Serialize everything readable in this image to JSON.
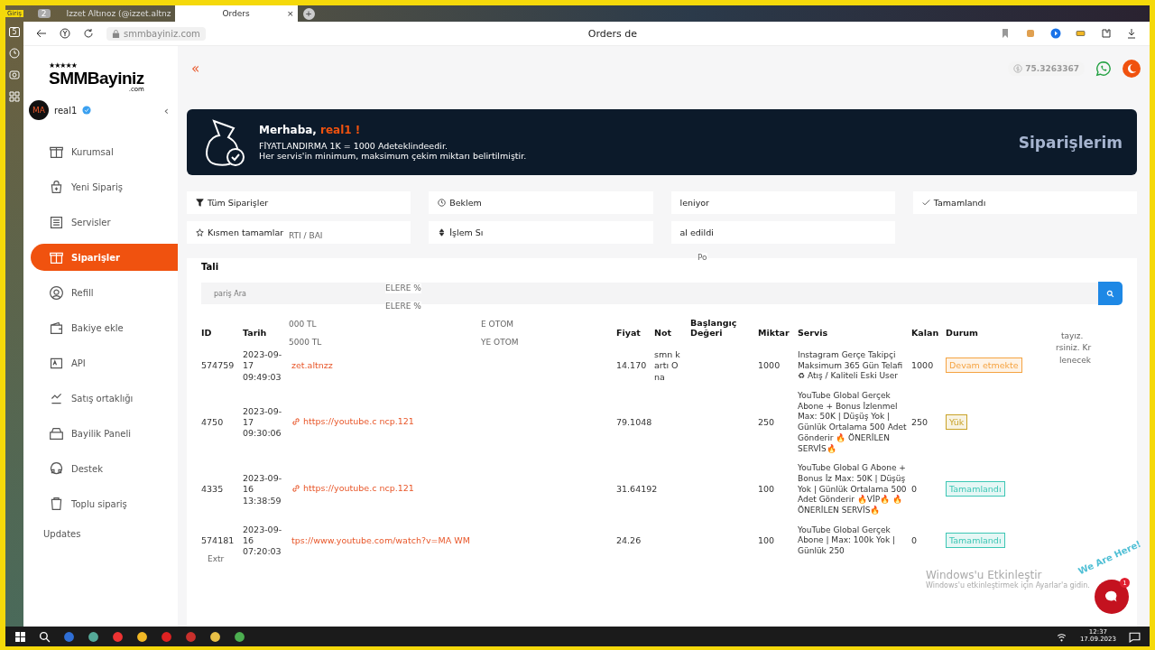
{
  "browser": {
    "corner_label": "Giriş",
    "tab_count": "2",
    "side_badge": "5",
    "tabs": [
      {
        "label": "Izzet Altınoz (@izzet.altnz",
        "selected": false
      },
      {
        "label": "Orders",
        "selected": true
      }
    ],
    "close": "×",
    "new_tab": "+",
    "url": "smmbayiniz.com",
    "page_title": "Orders de"
  },
  "sidebar": {
    "logo_stars": "★★★★★",
    "logo": "SMMBayiniz",
    "logo_sub": ".com",
    "avatar": "MA",
    "user": "real1",
    "collapse": "‹",
    "items": [
      {
        "label": "Kurumsal",
        "selected": false
      },
      {
        "label": "Yeni Sipariş",
        "selected": false
      },
      {
        "label": "Servisler",
        "selected": false
      },
      {
        "label": "Siparişler",
        "selected": true
      },
      {
        "label": "Refill",
        "selected": false
      },
      {
        "label": "Bakiye ekle",
        "selected": false
      },
      {
        "label": "API",
        "selected": false
      },
      {
        "label": "Satış ortaklığı",
        "selected": false
      },
      {
        "label": "Bayilik Paneli",
        "selected": false
      },
      {
        "label": "Destek",
        "selected": false
      },
      {
        "label": "Toplu sipariş",
        "selected": false
      }
    ],
    "footer": "Updates"
  },
  "topbar": {
    "toggle": "«",
    "balance": "75.3263367"
  },
  "banner": {
    "greeting": "Merhaba, ",
    "name": "real1 !",
    "line_1": "FİYATLANDIRMA 1K = 1000 Adeteklindeedir.",
    "line_2": "Her servis'in minimum, maksimum çekim miktarı belirtilmiştir.",
    "title": "Siparişlerim"
  },
  "filters": [
    {
      "label": "Tüm Siparişler",
      "kind": "filter"
    },
    {
      "label": "Beklem",
      "kind": "clock"
    },
    {
      "label": "leniyor",
      "kind": "none"
    },
    {
      "label": "Tamamlandı",
      "kind": "check"
    },
    {
      "label": "Kısmen tamamlar",
      "kind": "star"
    },
    {
      "label": "İşlem Sı",
      "kind": "sort"
    },
    {
      "label": "al edildi",
      "kind": "none"
    }
  ],
  "table": {
    "title": "Tali",
    "search": {
      "placeholder": "pariş Ara"
    },
    "columns": [
      "ID",
      "Tarih",
      "",
      "Fiyat",
      "Not",
      "Başlangıç Değeri",
      "Miktar",
      "Servis",
      "Kalan",
      "Durum"
    ],
    "rows": [
      {
        "id": "574759",
        "date": "2023-09-17 09:49:03",
        "link": "zet.altnzz",
        "link_icon": false,
        "price": "14.170",
        "note": "smn kartı Ona",
        "start": "",
        "qty": "1000",
        "service": "Instagram Gerçe Takipçi Maksimum 365 Gün Telafi ♻ Atış / Kaliteli Eski User",
        "remain": "1000",
        "status": "Devam etmekte",
        "color": "#f5a341"
      },
      {
        "id": "4750",
        "date": "2023-09-17 09:30:06",
        "link": "https://youtube.c ncp.121",
        "link_icon": true,
        "price": "79.1048",
        "note": "",
        "start": "",
        "qty": "250",
        "service": "YouTube Global Gerçek Abone + Bonus İzlenmel Max: 50K | Düşüş Yok | Günlük Ortalama 500 Adet Gönderir 🔥 ÖNERİLEN SERVİS🔥",
        "remain": "250",
        "status": "Yük",
        "color": "#c9a227"
      },
      {
        "id": "4335",
        "date": "2023-09-16 13:38:59",
        "link": "https://youtube.c ncp.121",
        "link_icon": true,
        "price": "31.64192",
        "note": "",
        "start": "",
        "qty": "100",
        "service": "YouTube Global G Abone + Bonus İz Max: 50K | Düşüş Yok | Günlük Ortalama 500 Adet Gönderir 🔥VİP🔥 🔥 ÖNERİLEN SERVİS🔥",
        "remain": "0",
        "status": "Tamamlandı",
        "color": "#3cc6b4"
      },
      {
        "id": "574181",
        "date": "2023-09-16 07:20:03",
        "link": "tps://www.youtube.com/watch?v=MA WM",
        "link_icon": false,
        "price": "24.26",
        "note": "",
        "start": "",
        "qty": "100",
        "service": "YouTube Global Gerçek Abone | Max: 100k Yok | Günlük 250",
        "remain": "0",
        "status": "Tamamlandı",
        "color": "#3cc6b4"
      }
    ]
  },
  "ghosts": [
    "RTI / BAI",
    "ELERE %",
    "ELERE %",
    "000 TL",
    "5000 TL",
    "E OTOM",
    "YE OTOM",
    "tayız.",
    "rsiniz. Kr",
    "lenecek",
    "Extr",
    "Po"
  ],
  "activation": {
    "title": "Windows'u Etkinleştir",
    "text": "Windows'u etkinleştirmek için Ayarlar'a gidin."
  },
  "chat": {
    "caption": "We Are Here!",
    "badge": "1"
  },
  "taskbar": {
    "time": "12:37",
    "date": "17.09.2023"
  }
}
